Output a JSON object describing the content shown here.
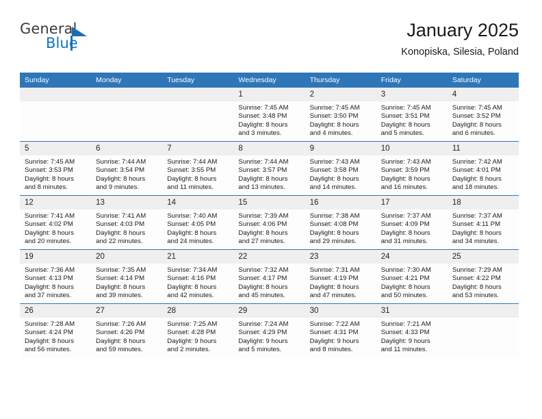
{
  "brand": {
    "name_part1": "General",
    "name_part2": "Blue",
    "accent_color": "#1173c4",
    "logo_icon": "triangle-logo-icon"
  },
  "header": {
    "title": "January 2025",
    "subtitle": "Konopiska, Silesia, Poland"
  },
  "colors": {
    "header_blue": "#2e76b8",
    "daynum_band": "#efefef",
    "cell_bg": "#fdfdfd",
    "text": "#1a1a1a"
  },
  "weekdays": [
    "Sunday",
    "Monday",
    "Tuesday",
    "Wednesday",
    "Thursday",
    "Friday",
    "Saturday"
  ],
  "weeks": [
    [
      {
        "day": "",
        "empty": true
      },
      {
        "day": "",
        "empty": true
      },
      {
        "day": "",
        "empty": true
      },
      {
        "day": "1",
        "sunrise": "Sunrise: 7:45 AM",
        "sunset": "Sunset: 3:48 PM",
        "daylight1": "Daylight: 8 hours",
        "daylight2": "and 3 minutes."
      },
      {
        "day": "2",
        "sunrise": "Sunrise: 7:45 AM",
        "sunset": "Sunset: 3:50 PM",
        "daylight1": "Daylight: 8 hours",
        "daylight2": "and 4 minutes."
      },
      {
        "day": "3",
        "sunrise": "Sunrise: 7:45 AM",
        "sunset": "Sunset: 3:51 PM",
        "daylight1": "Daylight: 8 hours",
        "daylight2": "and 5 minutes."
      },
      {
        "day": "4",
        "sunrise": "Sunrise: 7:45 AM",
        "sunset": "Sunset: 3:52 PM",
        "daylight1": "Daylight: 8 hours",
        "daylight2": "and 6 minutes."
      }
    ],
    [
      {
        "day": "5",
        "sunrise": "Sunrise: 7:45 AM",
        "sunset": "Sunset: 3:53 PM",
        "daylight1": "Daylight: 8 hours",
        "daylight2": "and 8 minutes."
      },
      {
        "day": "6",
        "sunrise": "Sunrise: 7:44 AM",
        "sunset": "Sunset: 3:54 PM",
        "daylight1": "Daylight: 8 hours",
        "daylight2": "and 9 minutes."
      },
      {
        "day": "7",
        "sunrise": "Sunrise: 7:44 AM",
        "sunset": "Sunset: 3:55 PM",
        "daylight1": "Daylight: 8 hours",
        "daylight2": "and 11 minutes."
      },
      {
        "day": "8",
        "sunrise": "Sunrise: 7:44 AM",
        "sunset": "Sunset: 3:57 PM",
        "daylight1": "Daylight: 8 hours",
        "daylight2": "and 13 minutes."
      },
      {
        "day": "9",
        "sunrise": "Sunrise: 7:43 AM",
        "sunset": "Sunset: 3:58 PM",
        "daylight1": "Daylight: 8 hours",
        "daylight2": "and 14 minutes."
      },
      {
        "day": "10",
        "sunrise": "Sunrise: 7:43 AM",
        "sunset": "Sunset: 3:59 PM",
        "daylight1": "Daylight: 8 hours",
        "daylight2": "and 16 minutes."
      },
      {
        "day": "11",
        "sunrise": "Sunrise: 7:42 AM",
        "sunset": "Sunset: 4:01 PM",
        "daylight1": "Daylight: 8 hours",
        "daylight2": "and 18 minutes."
      }
    ],
    [
      {
        "day": "12",
        "sunrise": "Sunrise: 7:41 AM",
        "sunset": "Sunset: 4:02 PM",
        "daylight1": "Daylight: 8 hours",
        "daylight2": "and 20 minutes."
      },
      {
        "day": "13",
        "sunrise": "Sunrise: 7:41 AM",
        "sunset": "Sunset: 4:03 PM",
        "daylight1": "Daylight: 8 hours",
        "daylight2": "and 22 minutes."
      },
      {
        "day": "14",
        "sunrise": "Sunrise: 7:40 AM",
        "sunset": "Sunset: 4:05 PM",
        "daylight1": "Daylight: 8 hours",
        "daylight2": "and 24 minutes."
      },
      {
        "day": "15",
        "sunrise": "Sunrise: 7:39 AM",
        "sunset": "Sunset: 4:06 PM",
        "daylight1": "Daylight: 8 hours",
        "daylight2": "and 27 minutes."
      },
      {
        "day": "16",
        "sunrise": "Sunrise: 7:38 AM",
        "sunset": "Sunset: 4:08 PM",
        "daylight1": "Daylight: 8 hours",
        "daylight2": "and 29 minutes."
      },
      {
        "day": "17",
        "sunrise": "Sunrise: 7:37 AM",
        "sunset": "Sunset: 4:09 PM",
        "daylight1": "Daylight: 8 hours",
        "daylight2": "and 31 minutes."
      },
      {
        "day": "18",
        "sunrise": "Sunrise: 7:37 AM",
        "sunset": "Sunset: 4:11 PM",
        "daylight1": "Daylight: 8 hours",
        "daylight2": "and 34 minutes."
      }
    ],
    [
      {
        "day": "19",
        "sunrise": "Sunrise: 7:36 AM",
        "sunset": "Sunset: 4:13 PM",
        "daylight1": "Daylight: 8 hours",
        "daylight2": "and 37 minutes."
      },
      {
        "day": "20",
        "sunrise": "Sunrise: 7:35 AM",
        "sunset": "Sunset: 4:14 PM",
        "daylight1": "Daylight: 8 hours",
        "daylight2": "and 39 minutes."
      },
      {
        "day": "21",
        "sunrise": "Sunrise: 7:34 AM",
        "sunset": "Sunset: 4:16 PM",
        "daylight1": "Daylight: 8 hours",
        "daylight2": "and 42 minutes."
      },
      {
        "day": "22",
        "sunrise": "Sunrise: 7:32 AM",
        "sunset": "Sunset: 4:17 PM",
        "daylight1": "Daylight: 8 hours",
        "daylight2": "and 45 minutes."
      },
      {
        "day": "23",
        "sunrise": "Sunrise: 7:31 AM",
        "sunset": "Sunset: 4:19 PM",
        "daylight1": "Daylight: 8 hours",
        "daylight2": "and 47 minutes."
      },
      {
        "day": "24",
        "sunrise": "Sunrise: 7:30 AM",
        "sunset": "Sunset: 4:21 PM",
        "daylight1": "Daylight: 8 hours",
        "daylight2": "and 50 minutes."
      },
      {
        "day": "25",
        "sunrise": "Sunrise: 7:29 AM",
        "sunset": "Sunset: 4:22 PM",
        "daylight1": "Daylight: 8 hours",
        "daylight2": "and 53 minutes."
      }
    ],
    [
      {
        "day": "26",
        "sunrise": "Sunrise: 7:28 AM",
        "sunset": "Sunset: 4:24 PM",
        "daylight1": "Daylight: 8 hours",
        "daylight2": "and 56 minutes."
      },
      {
        "day": "27",
        "sunrise": "Sunrise: 7:26 AM",
        "sunset": "Sunset: 4:26 PM",
        "daylight1": "Daylight: 8 hours",
        "daylight2": "and 59 minutes."
      },
      {
        "day": "28",
        "sunrise": "Sunrise: 7:25 AM",
        "sunset": "Sunset: 4:28 PM",
        "daylight1": "Daylight: 9 hours",
        "daylight2": "and 2 minutes."
      },
      {
        "day": "29",
        "sunrise": "Sunrise: 7:24 AM",
        "sunset": "Sunset: 4:29 PM",
        "daylight1": "Daylight: 9 hours",
        "daylight2": "and 5 minutes."
      },
      {
        "day": "30",
        "sunrise": "Sunrise: 7:22 AM",
        "sunset": "Sunset: 4:31 PM",
        "daylight1": "Daylight: 9 hours",
        "daylight2": "and 8 minutes."
      },
      {
        "day": "31",
        "sunrise": "Sunrise: 7:21 AM",
        "sunset": "Sunset: 4:33 PM",
        "daylight1": "Daylight: 9 hours",
        "daylight2": "and 11 minutes."
      },
      {
        "day": "",
        "empty": true
      }
    ]
  ]
}
